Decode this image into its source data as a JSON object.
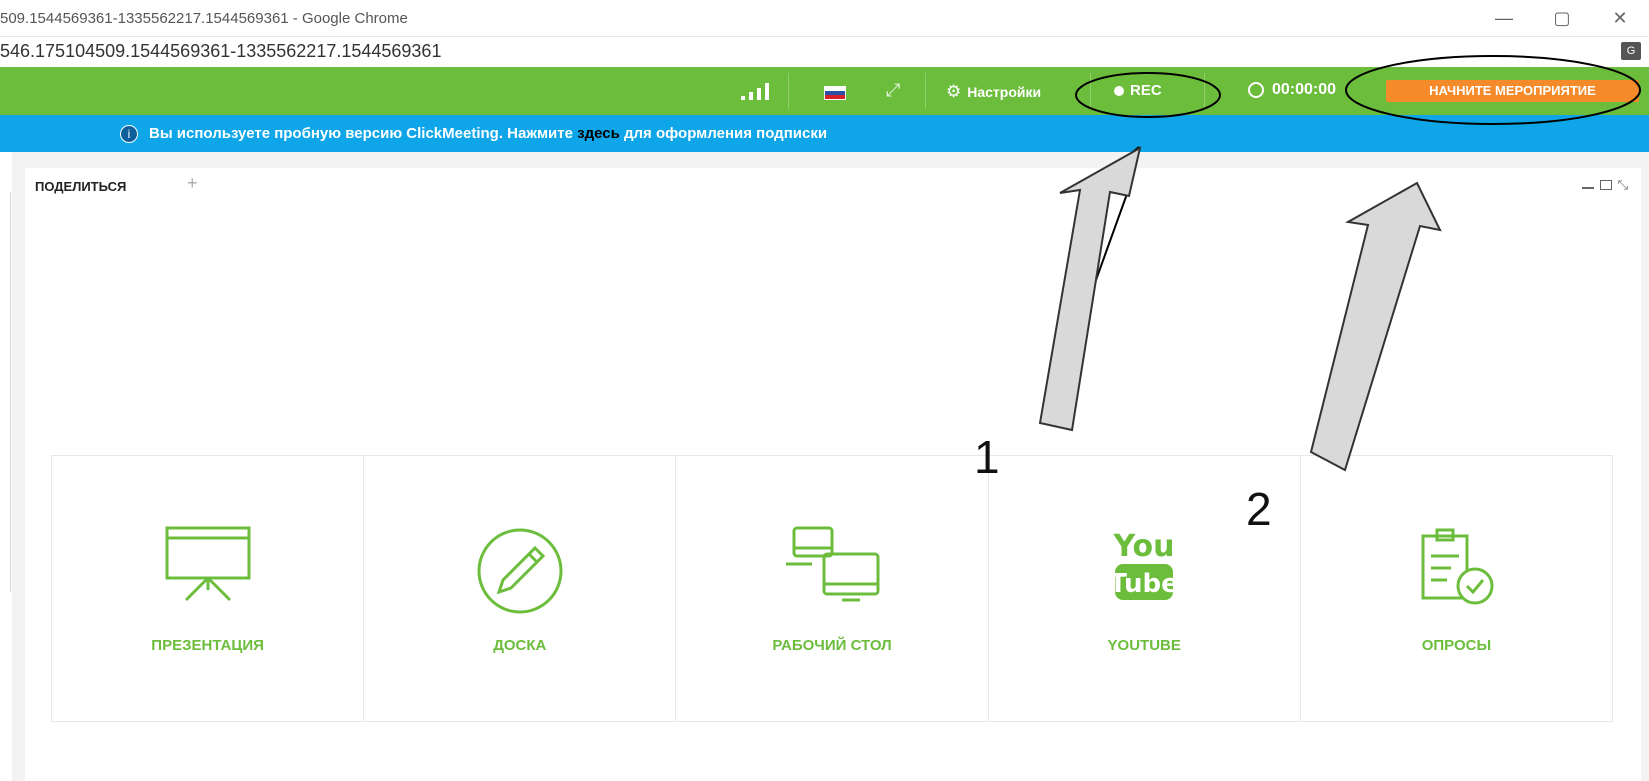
{
  "window": {
    "title": "509.1544569361-1335562217.1544569361 - Google Chrome",
    "url": "546.175104509.1544569361-1335562217.1544569361"
  },
  "topbar": {
    "settings_label": "Настройки",
    "rec_label": "REC",
    "timer": "00:00:00",
    "start_button": "НАЧНИТЕ МЕРОПРИЯТИЕ"
  },
  "notice": {
    "prefix": "Вы используете пробную версию ClickMeeting. Нажмите ",
    "link": "здесь",
    "suffix": " для оформления подписки"
  },
  "panel": {
    "tab": "ПОДЕЛИТЬСЯ",
    "add": "+"
  },
  "tiles": [
    {
      "label": "ПРЕЗЕНТАЦИЯ",
      "icon": "presentation-icon"
    },
    {
      "label": "ДОСКА",
      "icon": "pencil-icon"
    },
    {
      "label": "РАБОЧИЙ СТОЛ",
      "icon": "desktop-icon"
    },
    {
      "label": "YOUTUBE",
      "icon": "youtube-icon"
    },
    {
      "label": "ОПРОСЫ",
      "icon": "poll-icon"
    }
  ],
  "annotations": {
    "one": "1",
    "two": "2"
  },
  "colors": {
    "green": "#6cbd3c",
    "blue": "#0ea6e8",
    "orange": "#f58a2b"
  }
}
